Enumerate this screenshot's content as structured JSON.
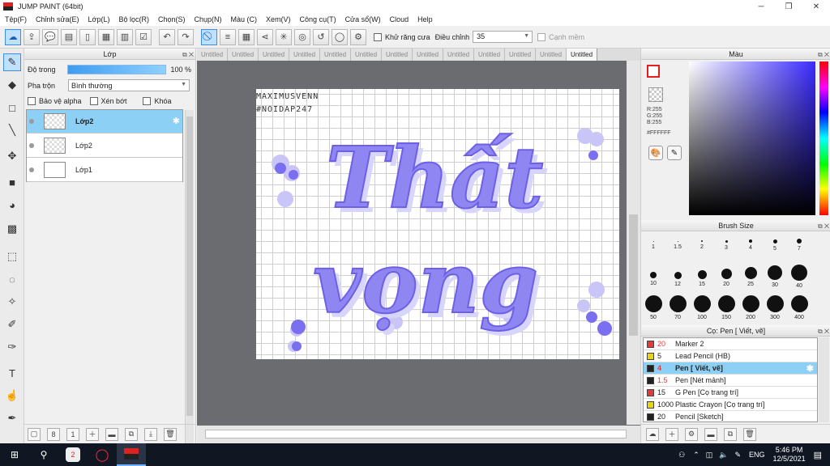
{
  "window": {
    "title": "JUMP PAINT (64bit)",
    "min": "─",
    "max": "❐",
    "close": "✕"
  },
  "menu": [
    "Tệp(F)",
    "Chỉnh sửa(E)",
    "Lớp(L)",
    "Bộ lọc(R)",
    "Chọn(S)",
    "Chụp(N)",
    "Màu (C)",
    "Xem(V)",
    "Công cụ(T)",
    "Cửa sổ(W)",
    "Cloud",
    "Help"
  ],
  "toolbar": {
    "antialias_label": "Khử răng cưa",
    "adjust_label": "Điều chỉnh",
    "adjust_value": "35",
    "edge_label": "Cạnh mềm"
  },
  "layer_panel": {
    "title": "Lớp",
    "opacity_label": "Độ trong",
    "opacity_value": "100 %",
    "opacity_level": 1.0,
    "blend_label": "Pha trộn",
    "blend_value": "Bình thường",
    "protect_alpha": "Bảo vệ alpha",
    "clipping": "Xén bớt",
    "lock": "Khóa",
    "layers": [
      {
        "name": "Lớp2",
        "selected": true
      },
      {
        "name": "Lớp2",
        "selected": false
      },
      {
        "name": "Lớp1",
        "selected": false
      }
    ]
  },
  "tabs": [
    "Untitled",
    "Untitled",
    "Untitled",
    "Untitled",
    "Untitled",
    "Untitled",
    "Untitled",
    "Untitled",
    "Untitled",
    "Untitled",
    "Untitled",
    "Untitled",
    "Untitled"
  ],
  "canvas": {
    "tag_line1": "MAXIMUSVENN",
    "tag_line2": "#NOIDAP247",
    "word1": "Thất",
    "word2": "vọng",
    "lettering_color": "#8f86f2"
  },
  "color_panel": {
    "title": "Màu",
    "r": "R:255",
    "g": "G:255",
    "b": "B:255",
    "hex": "#FFFFFF"
  },
  "brush_panel": {
    "title": "Brush Size",
    "sizes": [
      "1",
      "1.5",
      "2",
      "3",
      "4",
      "5",
      "7",
      "10",
      "12",
      "15",
      "20",
      "25",
      "30",
      "40",
      "50",
      "70",
      "100",
      "150",
      "200",
      "300",
      "400"
    ]
  },
  "pen_panel": {
    "title": "Cọ: Pen [ Viết, vẽ]",
    "pens": [
      {
        "size": "20",
        "name": "Marker 2",
        "color": "#e63a3a",
        "size_red": true
      },
      {
        "size": "5",
        "name": "Lead Pencil (HB)",
        "color": "#e8d40f",
        "size_red": false
      },
      {
        "size": "4",
        "name": "Pen [ Viết, vẽ]",
        "color": "#222222",
        "size_red": true
      },
      {
        "size": "1.5",
        "name": "Pen [Nét mảnh]",
        "color": "#222222",
        "size_red": true
      },
      {
        "size": "15",
        "name": "G Pen [Cọ trang trí]",
        "color": "#e63a3a",
        "size_red": false
      },
      {
        "size": "1000",
        "name": "Plastic Crayon [Cọ trang trí]",
        "color": "#e8d40f",
        "size_red": false
      },
      {
        "size": "20",
        "name": "Pencil [Sketch]",
        "color": "#222222",
        "size_red": false
      }
    ]
  },
  "taskbar": {
    "time": "5:46 PM",
    "date": "12/5/2021",
    "lang": "ENG",
    "notif_badge": "2"
  }
}
